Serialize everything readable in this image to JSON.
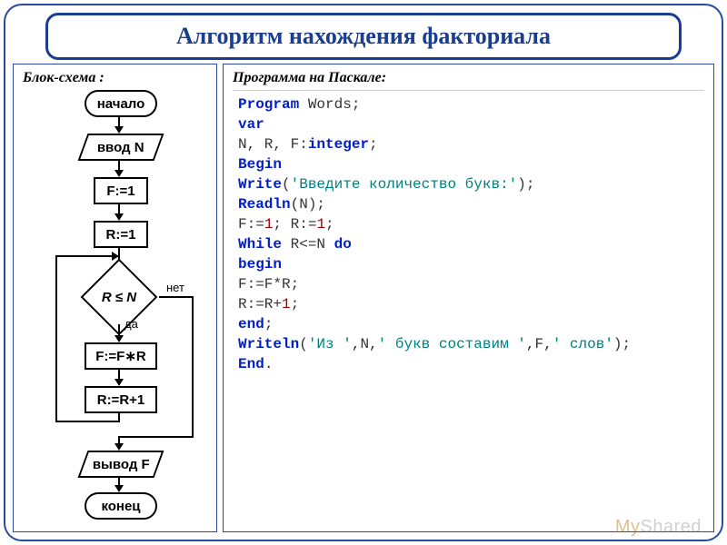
{
  "title": "Алгоритм нахождения факториала",
  "left_heading": "Блок-схема :",
  "right_heading": "Программа на Паскале:",
  "flow": {
    "start": "начало",
    "input": "ввод N",
    "p1": "F:=1",
    "p2": "R:=1",
    "cond": "R ≤ N",
    "yes": "да",
    "no": "нет",
    "p3": "F:=F∗R",
    "p4": "R:=R+1",
    "output": "вывод F",
    "end": "конец"
  },
  "code": {
    "l1a": "Program",
    "l1b": " Words;",
    "l2": "var",
    "l3a": "N, R, F:",
    "l3b": "integer",
    "l3c": ";",
    "l4": "Begin",
    "l5a": "Write",
    "l5b": "(",
    "l5c": "'Введите количество букв:'",
    "l5d": ");",
    "l6a": "Readln",
    "l6b": "(N);",
    "l7a": "F:=",
    "l7b": "1",
    "l7c": "; R:=",
    "l7d": "1",
    "l7e": ";",
    "l8a": "While",
    "l8b": " R<=N ",
    "l8c": "do",
    "l9": "begin",
    "l10a": "F:=F*R;",
    "l11a": "R:=R+",
    "l11b": "1",
    "l11c": ";",
    "l12a": "end",
    "l12b": ";",
    "l13a": "Writeln",
    "l13b": "(",
    "l13c": "'Из '",
    "l13d": ",N,",
    "l13e": "' букв составим '",
    "l13f": ",F,",
    "l13g": "' слов'",
    "l13h": ");",
    "l14a": "End",
    "l14b": "."
  },
  "watermark_a": "My",
  "watermark_b": "Shared"
}
